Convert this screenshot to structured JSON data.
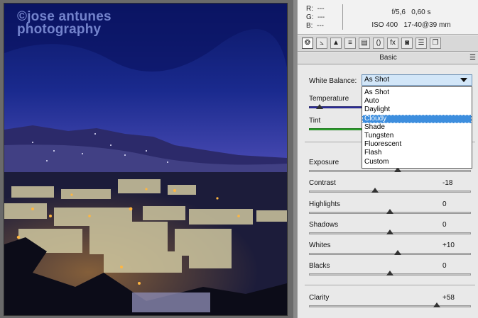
{
  "watermark": {
    "line1": "©jose antunes",
    "line2": "photography"
  },
  "readout": {
    "r_label": "R:",
    "r_value": "---",
    "g_label": "G:",
    "g_value": "---",
    "b_label": "B:",
    "b_value": "---",
    "aperture": "f/5,6",
    "shutter": "0,60 s",
    "iso": "ISO 400",
    "lens": "17-40@39 mm"
  },
  "toolbar": {
    "tools": [
      {
        "name": "basic",
        "icon": "camera-aperture-icon",
        "glyph": "❂"
      },
      {
        "name": "tone-curve",
        "icon": "tone-curve-icon",
        "glyph": "⦣"
      },
      {
        "name": "detail",
        "icon": "detail-triangle-icon",
        "glyph": "▲"
      },
      {
        "name": "hsl",
        "icon": "hsl-bars-icon",
        "glyph": "≡"
      },
      {
        "name": "split-toning",
        "icon": "split-toning-icon",
        "glyph": "▤"
      },
      {
        "name": "lens-corrections",
        "icon": "lens-icon",
        "glyph": "()"
      },
      {
        "name": "effects",
        "icon": "fx-icon",
        "glyph": "fx"
      },
      {
        "name": "camera-calibration",
        "icon": "camera-icon",
        "glyph": "◙"
      },
      {
        "name": "presets",
        "icon": "presets-icon",
        "glyph": "☰"
      },
      {
        "name": "snapshots",
        "icon": "snapshots-icon",
        "glyph": "❐"
      }
    ]
  },
  "panel": {
    "title": "Basic",
    "white_balance": {
      "label": "White Balance:",
      "selected": "As Shot",
      "options": [
        "As Shot",
        "Auto",
        "Daylight",
        "Cloudy",
        "Shade",
        "Tungsten",
        "Fluorescent",
        "Flash",
        "Custom"
      ],
      "highlighted": "Cloudy"
    },
    "temperature": {
      "label": "Temperature",
      "value": "",
      "level": 0.2
    },
    "tint": {
      "label": "Tint",
      "value": "",
      "level": 0.5
    },
    "sliders": [
      {
        "key": "exposure",
        "label": "Exposure",
        "value": "",
        "level": 0.55
      },
      {
        "key": "contrast",
        "label": "Contrast",
        "value": "-18",
        "level": 0.41
      },
      {
        "key": "highlights",
        "label": "Highlights",
        "value": "0",
        "level": 0.5
      },
      {
        "key": "shadows",
        "label": "Shadows",
        "value": "0",
        "level": 0.5
      },
      {
        "key": "whites",
        "label": "Whites",
        "value": "+10",
        "level": 0.55
      },
      {
        "key": "blacks",
        "label": "Blacks",
        "value": "0",
        "level": 0.5
      },
      {
        "key": "clarity",
        "label": "Clarity",
        "value": "+58",
        "level": 0.79
      }
    ]
  },
  "colors": {
    "accent": "#3d8ede",
    "sky_top": "#0f1c78",
    "sky_bottom": "#6a62c8"
  }
}
